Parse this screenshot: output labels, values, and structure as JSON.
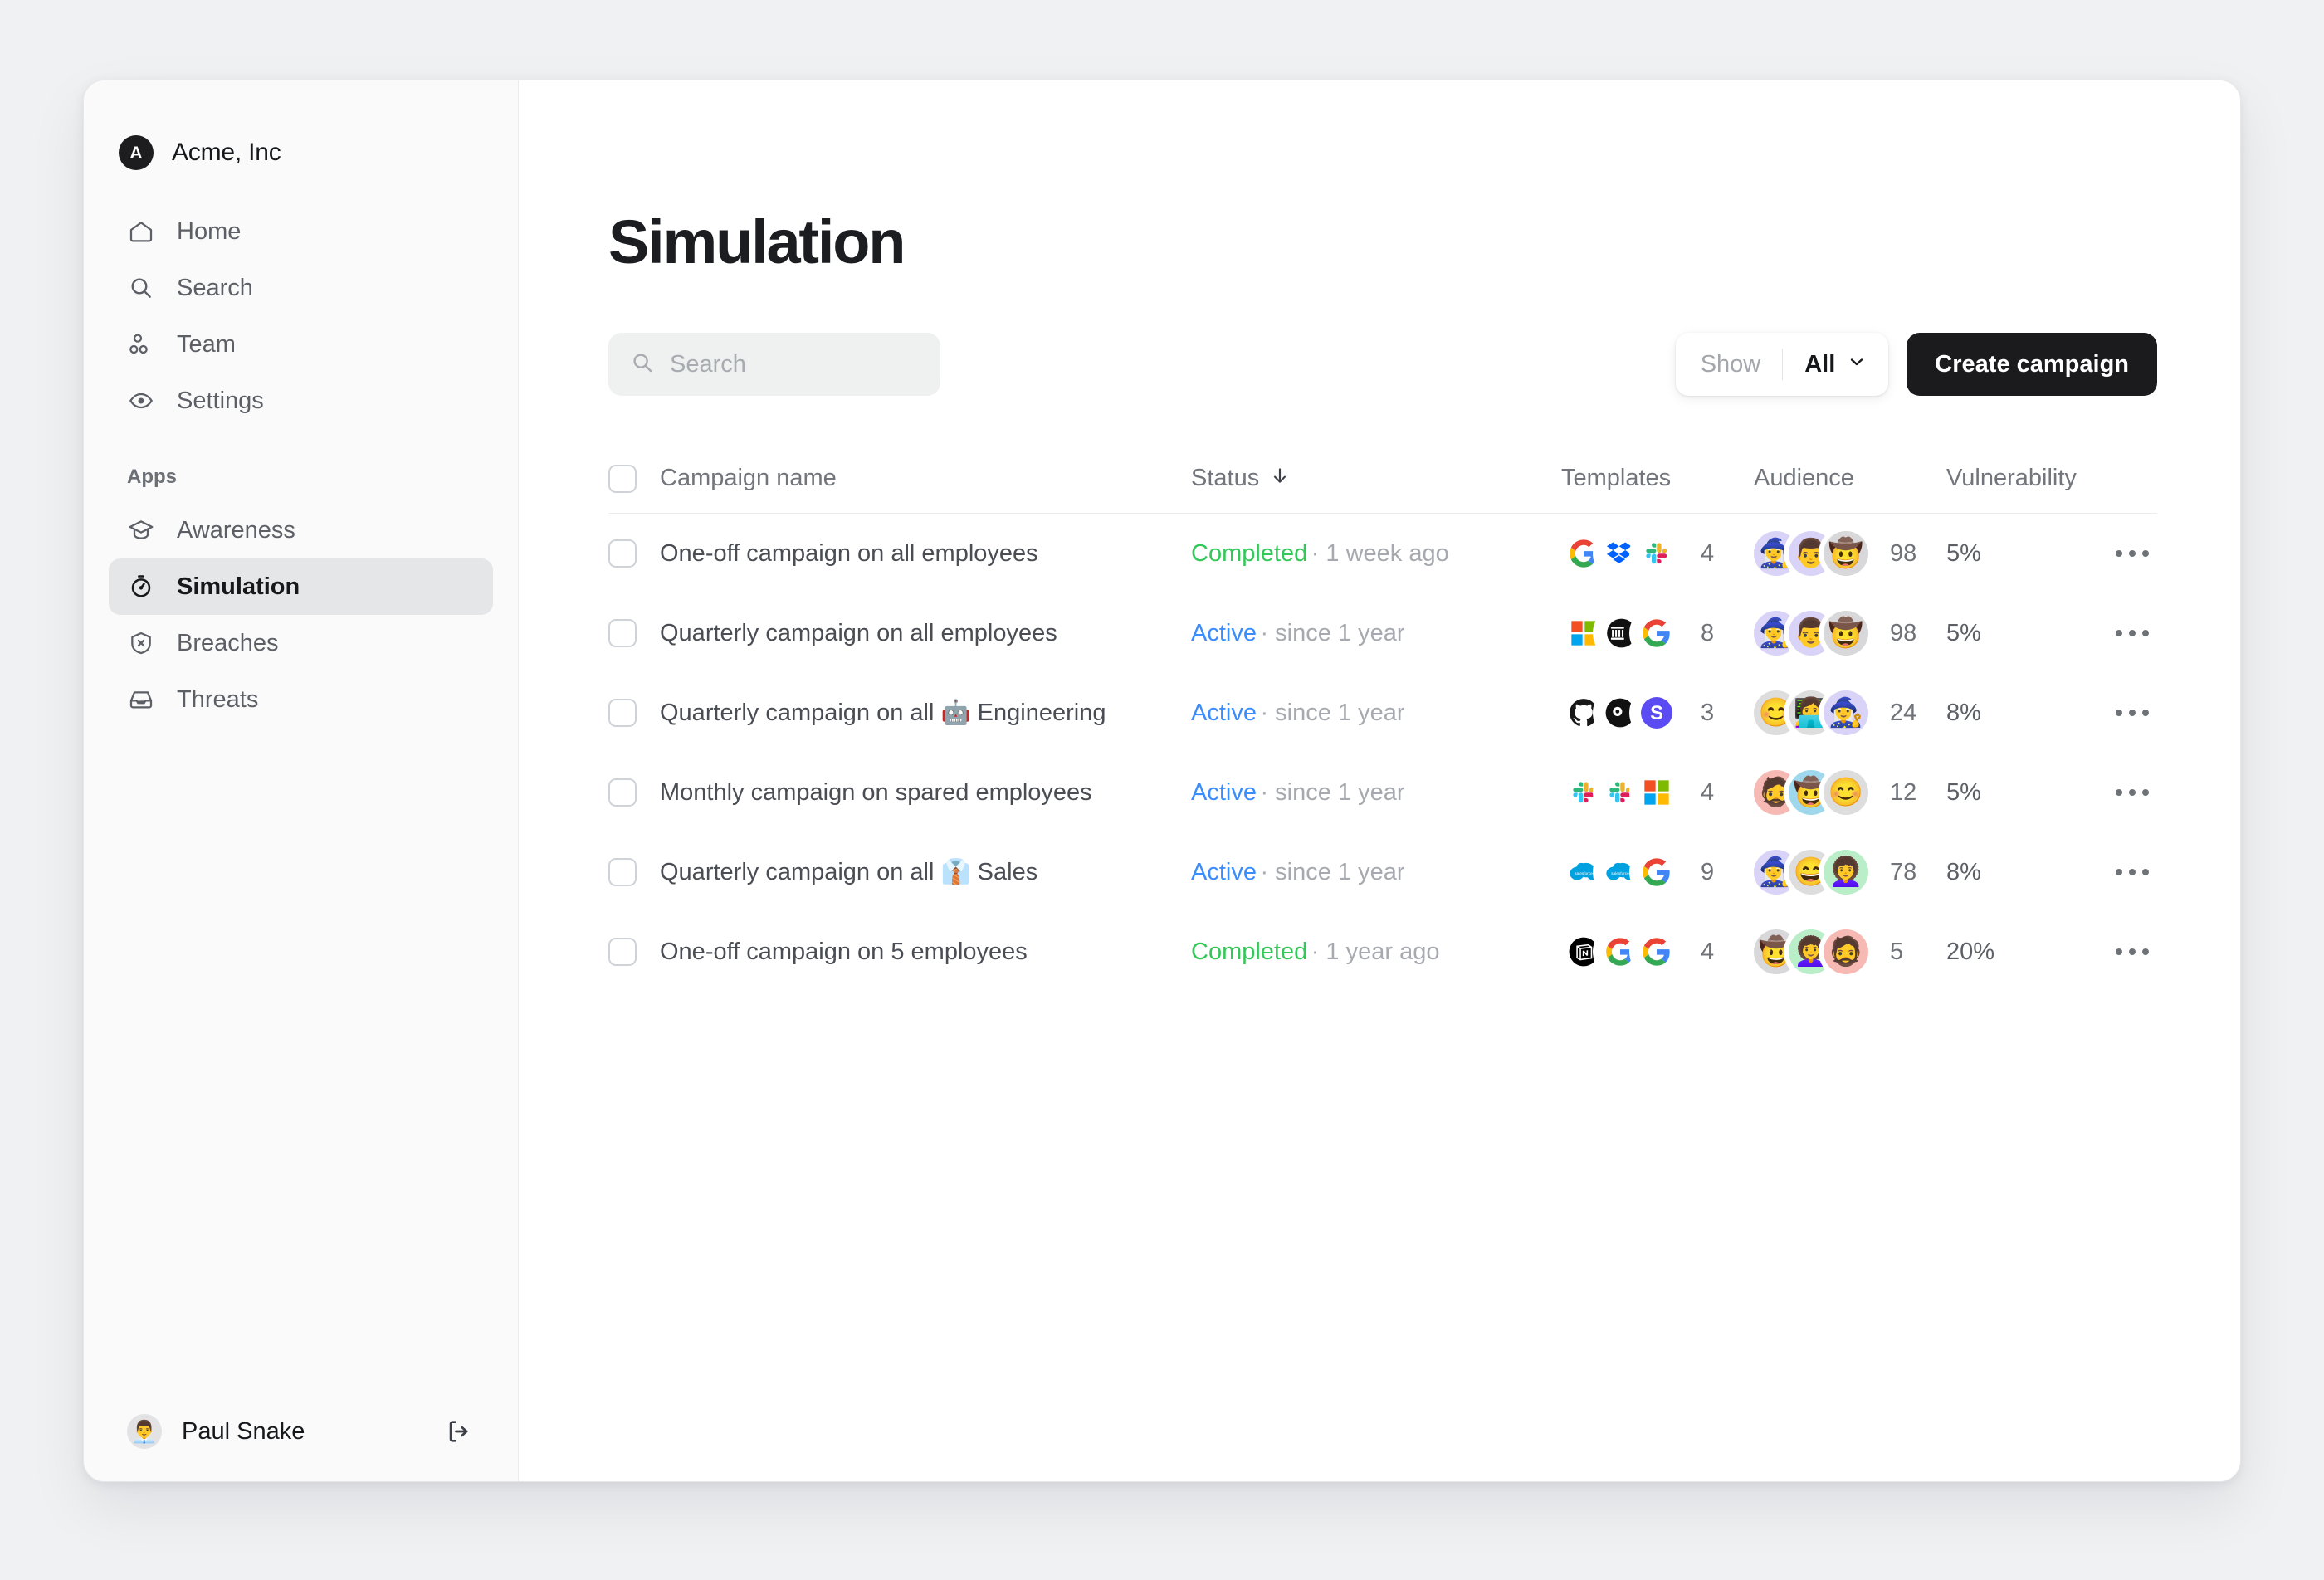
{
  "sidebar": {
    "brand": {
      "initial": "A",
      "name": "Acme, Inc"
    },
    "nav": [
      {
        "label": "Home",
        "icon": "home-icon"
      },
      {
        "label": "Search",
        "icon": "search-icon"
      },
      {
        "label": "Team",
        "icon": "team-icon"
      },
      {
        "label": "Settings",
        "icon": "settings-icon"
      }
    ],
    "section_label": "Apps",
    "apps": [
      {
        "label": "Awareness",
        "icon": "graduation-cap-icon",
        "active": false
      },
      {
        "label": "Simulation",
        "icon": "stopwatch-icon",
        "active": true
      },
      {
        "label": "Breaches",
        "icon": "shield-x-icon",
        "active": false
      },
      {
        "label": "Threats",
        "icon": "inbox-icon",
        "active": false
      }
    ],
    "footer": {
      "user_name": "Paul Snake",
      "avatar_emoji": "👨‍💼",
      "logout_icon": "logout-icon"
    }
  },
  "main": {
    "title": "Simulation",
    "search": {
      "placeholder": "Search",
      "value": ""
    },
    "show_filter": {
      "label": "Show",
      "value": "All"
    },
    "create_button": "Create campaign",
    "table": {
      "columns": [
        "Campaign name",
        "Status",
        "Templates",
        "Audience",
        "Vulnerability"
      ],
      "sort_column": "Status",
      "sort_direction": "desc",
      "rows": [
        {
          "name": "One-off campaign on all employees",
          "emoji": "",
          "status": "Completed",
          "status_type": "completed",
          "status_meta": "· 1 week ago",
          "templates": [
            "google",
            "dropbox",
            "slack"
          ],
          "template_count": "4",
          "audience": [
            "🧙‍♀️",
            "👨",
            "🤠"
          ],
          "audience_colors": [
            "#d9d4f7",
            "#d9d4f7",
            "#d8d8da"
          ],
          "audience_count": "98",
          "vulnerability": "5%"
        },
        {
          "name": "Quarterly campaign on all employees",
          "emoji": "",
          "status": "Active",
          "status_type": "active",
          "status_meta": "· since 1 year",
          "templates": [
            "microsoft",
            "github-dark",
            "google"
          ],
          "template_count": "8",
          "audience": [
            "🧙‍♀️",
            "👨",
            "🤠"
          ],
          "audience_colors": [
            "#d9d4f7",
            "#d9d4f7",
            "#d8d8da"
          ],
          "audience_count": "98",
          "vulnerability": "5%"
        },
        {
          "name": "Quarterly campaign on all 🤖 Engineering",
          "emoji": "🤖",
          "status": "Active",
          "status_type": "active",
          "status_meta": "· since 1 year",
          "templates": [
            "github",
            "vercel",
            "slack-s"
          ],
          "template_count": "3",
          "audience": [
            "😊",
            "👩‍💻",
            "🧙‍♀️"
          ],
          "audience_colors": [
            "#ddddde",
            "#ddddde",
            "#d9d4f7"
          ],
          "audience_count": "24",
          "vulnerability": "8%"
        },
        {
          "name": "Monthly campaign on spared employees",
          "emoji": "",
          "status": "Active",
          "status_type": "active",
          "status_meta": "· since 1 year",
          "templates": [
            "slack",
            "slack",
            "microsoft"
          ],
          "template_count": "4",
          "audience": [
            "🧔",
            "🤠",
            "😊"
          ],
          "audience_colors": [
            "#f7b9b4",
            "#9fd8ec",
            "#ddddde"
          ],
          "audience_count": "12",
          "vulnerability": "5%"
        },
        {
          "name": "Quarterly campaign on all 👔 Sales",
          "emoji": "👔",
          "status": "Active",
          "status_type": "active",
          "status_meta": "· since 1 year",
          "templates": [
            "salesforce",
            "salesforce",
            "google"
          ],
          "template_count": "9",
          "audience": [
            "🧙‍♀️",
            "😄",
            "👩‍🦱"
          ],
          "audience_colors": [
            "#d9d4f7",
            "#ddddde",
            "#b9eec8"
          ],
          "audience_count": "78",
          "vulnerability": "8%"
        },
        {
          "name": "One-off campaign on 5 employees",
          "emoji": "",
          "status": "Completed",
          "status_type": "completed",
          "status_meta": "· 1 year ago",
          "templates": [
            "notion",
            "google",
            "google"
          ],
          "template_count": "4",
          "audience": [
            "🤠",
            "👩‍🦱",
            "🧔"
          ],
          "audience_colors": [
            "#d8d8da",
            "#b9eec8",
            "#f7b9b4"
          ],
          "audience_count": "5",
          "vulnerability": "20%"
        }
      ]
    }
  },
  "colors": {
    "accent_active": "#3a8dfd",
    "accent_completed": "#35c759",
    "primary_button_bg": "#1b1b1d",
    "sidebar_bg": "#fafafa",
    "page_bg": "#f0f1f3"
  }
}
